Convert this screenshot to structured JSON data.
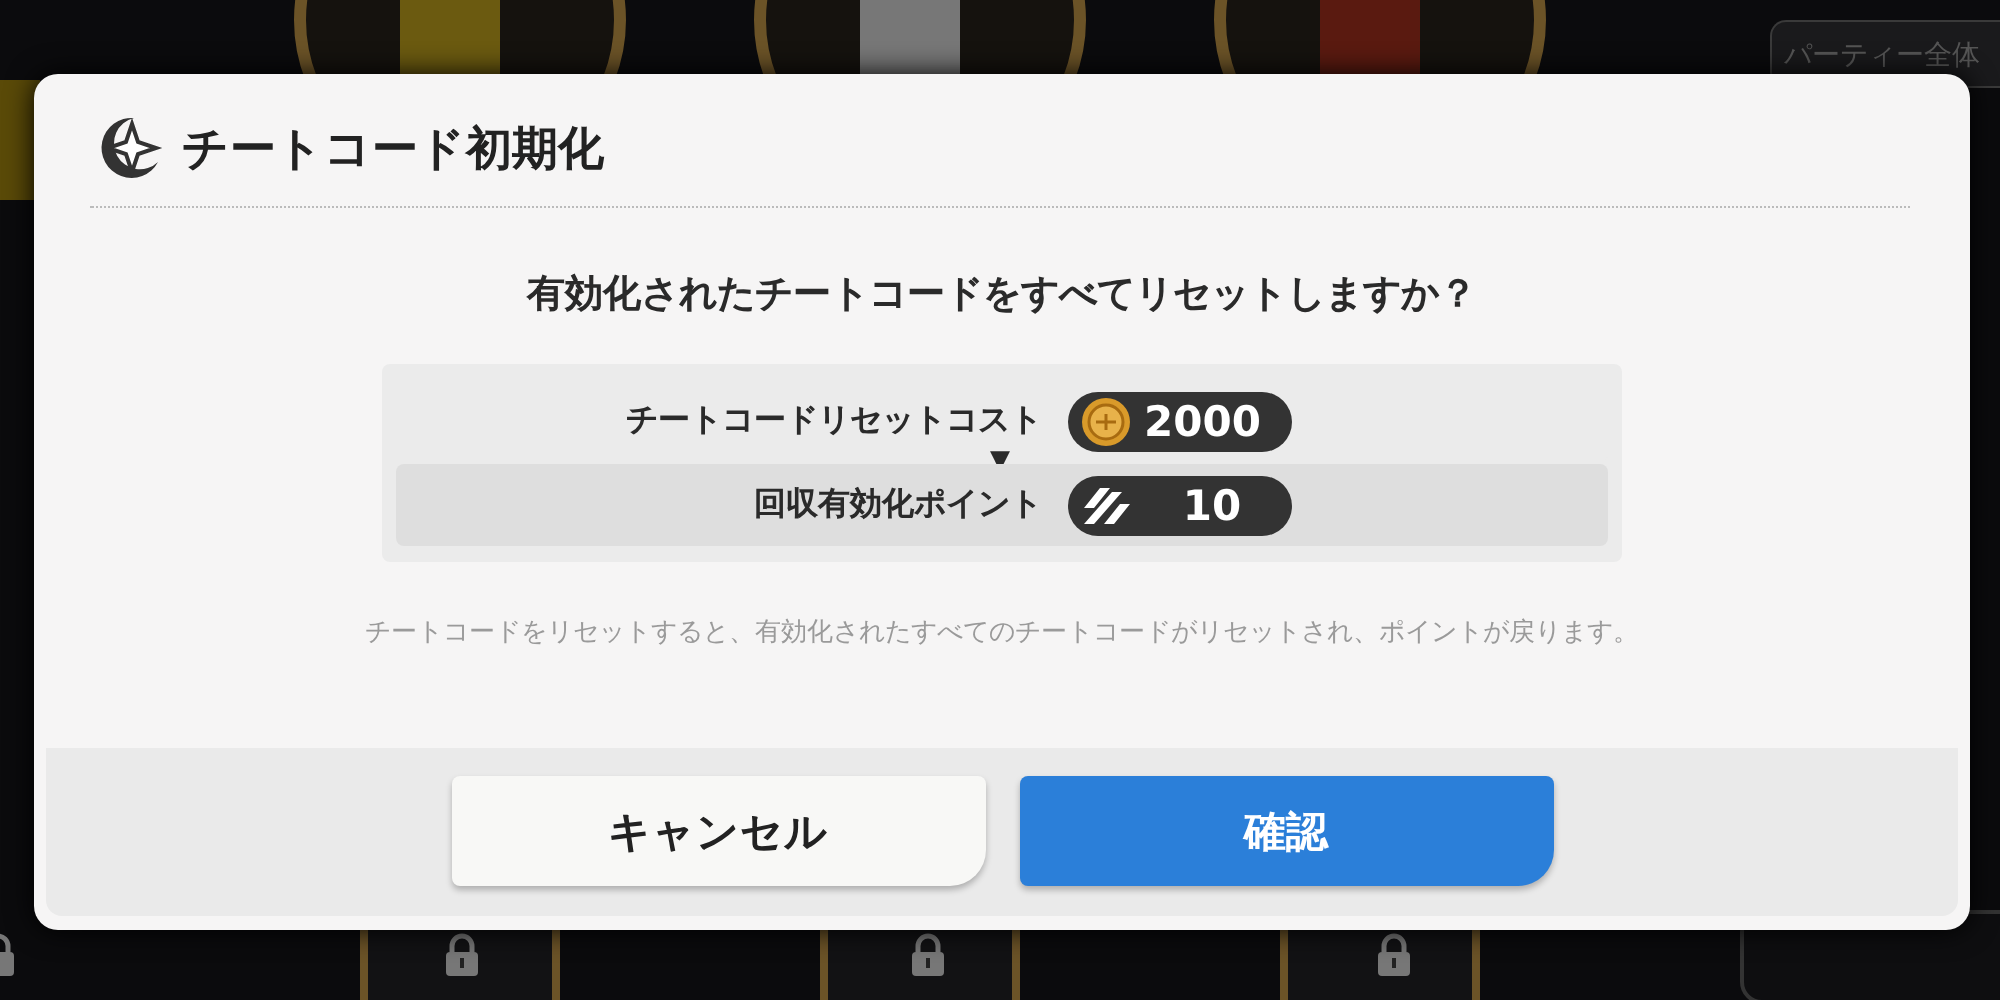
{
  "background": {
    "party_label": "パーティー全体",
    "locked_slots": [
      true,
      true,
      true,
      true
    ]
  },
  "dialog": {
    "title": "チートコード初期化",
    "question": "有効化されたチートコードをすべてリセットしますか？",
    "rows": [
      {
        "label": "チートコードリセットコスト",
        "kind": "coin",
        "value": "2000",
        "highlighted": false
      },
      {
        "label": "回収有効化ポイント",
        "kind": "points",
        "value": "10",
        "highlighted": true
      }
    ],
    "arrow": "▼",
    "note": "チートコードをリセットすると、有効化されたすべてのチートコードがリセットされ、ポイントが戻ります。",
    "buttons": [
      {
        "label": "キャンセル",
        "kind": "secondary"
      },
      {
        "label": "確認",
        "kind": "primary"
      }
    ]
  }
}
